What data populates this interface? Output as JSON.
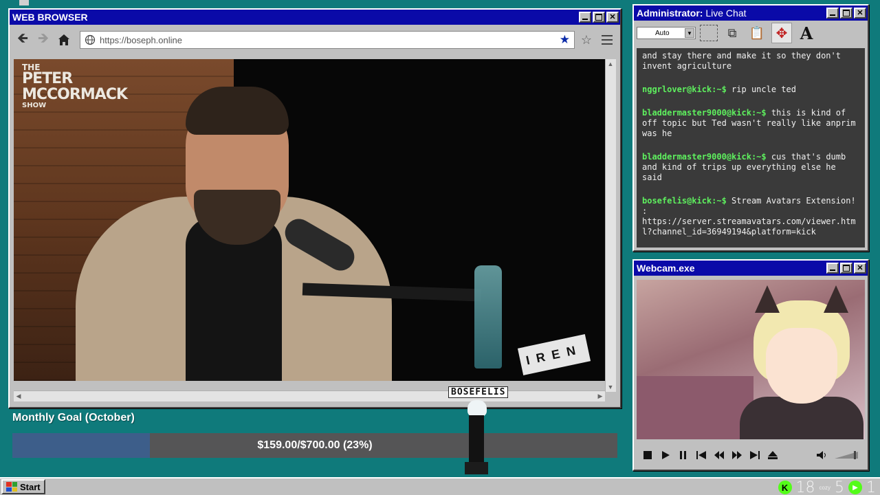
{
  "browser": {
    "title": "WEB BROWSER",
    "url": "https://boseph.online",
    "video": {
      "show_logo": [
        "THE",
        "PETER",
        "MCCORMACK",
        "SHOW"
      ],
      "sign": "IREN"
    }
  },
  "chat": {
    "title_prefix": "Administrator:",
    "title_main": "Live Chat",
    "select_value": "Auto",
    "messages": [
      {
        "user": "",
        "text": "and stay there and make it so they don't invent agriculture"
      },
      {
        "user": "nggrlover@kick:~$",
        "text": " rip uncle ted"
      },
      {
        "user": "bladdermaster9000@kick:~$",
        "text": " this is kind of off topic but Ted wasn't really like anprim was he"
      },
      {
        "user": "bladdermaster9000@kick:~$",
        "text": " cus that's dumb and kind of trips up everything else he said"
      },
      {
        "user": "bosefelis@kick:~$",
        "text": " Stream Avatars Extension! : https://server.streamavatars.com/viewer.html?channel_id=36949194&platform=kick"
      }
    ]
  },
  "webcam": {
    "title": "Webcam.exe"
  },
  "goal": {
    "title": "Monthly Goal (October)",
    "text": "$159.00/$700.00 (23%)",
    "progress_percent": 22.7
  },
  "avatar": {
    "name": "BOSEFELIS"
  },
  "taskbar": {
    "start_label": "Start",
    "tray": {
      "kick_count": "18",
      "cozy_label": "cozy",
      "cozy_count": "5",
      "play_count": "1"
    }
  },
  "colors": {
    "desktop": "#0f7a7b",
    "titlebar": "#0a0aa8",
    "chat_bg": "#3a3a3a",
    "chat_user": "#5ef05e",
    "goal_fill": "#3d5e8a",
    "goal_track": "#555556",
    "kick_green": "#53fc18"
  },
  "icons": {
    "back": "arrow-left-icon",
    "forward": "arrow-right-icon",
    "home": "home-icon",
    "globe": "globe-icon",
    "bookmark": "star-filled-icon",
    "favorite": "star-outline-icon",
    "menu": "hamburger-icon"
  }
}
